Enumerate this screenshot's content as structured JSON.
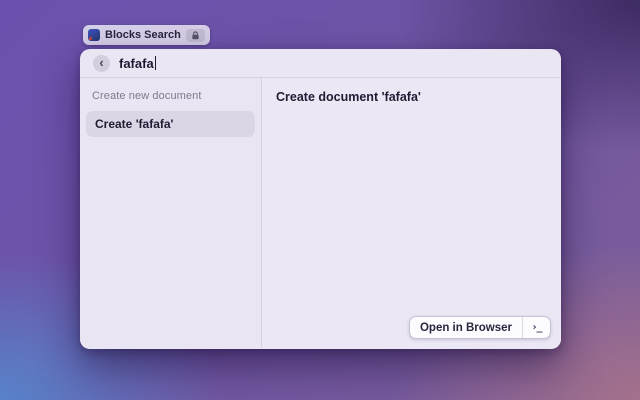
{
  "badge": {
    "label": "Blocks Search",
    "icons": {
      "app": "blocks-app-icon",
      "lock": "lock-icon"
    }
  },
  "window": {
    "search": {
      "value": "fafafa",
      "back_glyph": "‹"
    },
    "sidebar": {
      "section_header": "Create new document",
      "items": [
        {
          "label": "Create 'fafafa'",
          "selected": true
        }
      ]
    },
    "detail": {
      "title": "Create document 'fafafa'"
    },
    "footer": {
      "open_button_label": "Open in Browser",
      "terminal_glyph": "›_"
    }
  },
  "colors": {
    "window_bg": "#ebe6f3",
    "selection_bg": "#dcd5e6",
    "text_primary": "#211b33",
    "text_muted": "#7f7a8c",
    "bg_corner_top_left": "#6a51ae",
    "bg_corner_top_right": "#3a285f",
    "bg_corner_bottom_left": "#5685cb",
    "bg_corner_bottom_right": "#a7728b"
  }
}
